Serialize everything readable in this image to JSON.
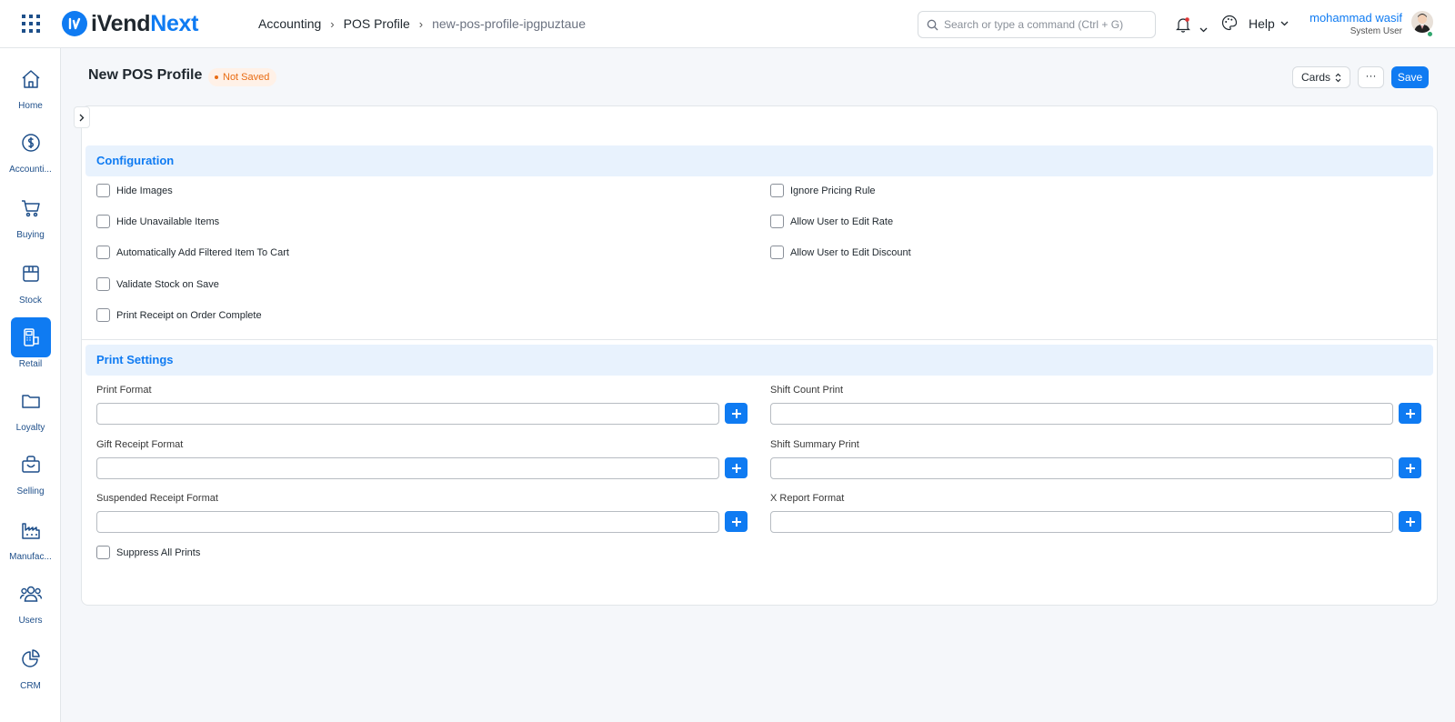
{
  "brand": {
    "name_part1": "iVend",
    "name_part2": "Next",
    "logo_icon": "ivendnext-logo-icon"
  },
  "breadcrumb": [
    "Accounting",
    "POS Profile",
    "new-pos-profile-ipgpuztaue"
  ],
  "search": {
    "placeholder": "Search or type a command (Ctrl + G)"
  },
  "navbar": {
    "help_label": "Help",
    "icons": [
      "apps-grid-icon",
      "bell-icon",
      "palette-icon"
    ]
  },
  "user": {
    "name": "mohammad wasif",
    "role": "System User"
  },
  "sidebar": {
    "items": [
      {
        "label": "Home",
        "icon": "home-icon"
      },
      {
        "label": "Accounti...",
        "icon": "dollar-circle-icon"
      },
      {
        "label": "Buying",
        "icon": "cart-icon"
      },
      {
        "label": "Stock",
        "icon": "box-icon"
      },
      {
        "label": "Retail",
        "icon": "pos-terminal-icon",
        "active": true
      },
      {
        "label": "Loyalty",
        "icon": "folder-icon"
      },
      {
        "label": "Selling",
        "icon": "shopping-bag-icon"
      },
      {
        "label": "Manufac...",
        "icon": "factory-icon"
      },
      {
        "label": "Users",
        "icon": "users-icon"
      },
      {
        "label": "CRM",
        "icon": "pie-chart-icon"
      }
    ]
  },
  "page": {
    "title": "New POS Profile",
    "status": "Not Saved",
    "view_label": "Cards",
    "more_label": "···",
    "save_label": "Save"
  },
  "configuration": {
    "heading": "Configuration",
    "left": [
      "Hide Images",
      "Hide Unavailable Items",
      "Automatically Add Filtered Item To Cart",
      "Validate Stock on Save",
      "Print Receipt on Order Complete"
    ],
    "right": [
      "Ignore Pricing Rule",
      "Allow User to Edit Rate",
      "Allow User to Edit Discount"
    ]
  },
  "print_settings": {
    "heading": "Print Settings",
    "left_fields": [
      "Print Format",
      "Gift Receipt Format",
      "Suspended Receipt Format"
    ],
    "right_fields": [
      "Shift Count Print",
      "Shift Summary Print",
      "X Report Format"
    ],
    "suppress_label": "Suppress All Prints"
  },
  "colors": {
    "accent": "#0f7bf2",
    "status": "#e86c13",
    "section_bg": "#e8f2fd"
  }
}
